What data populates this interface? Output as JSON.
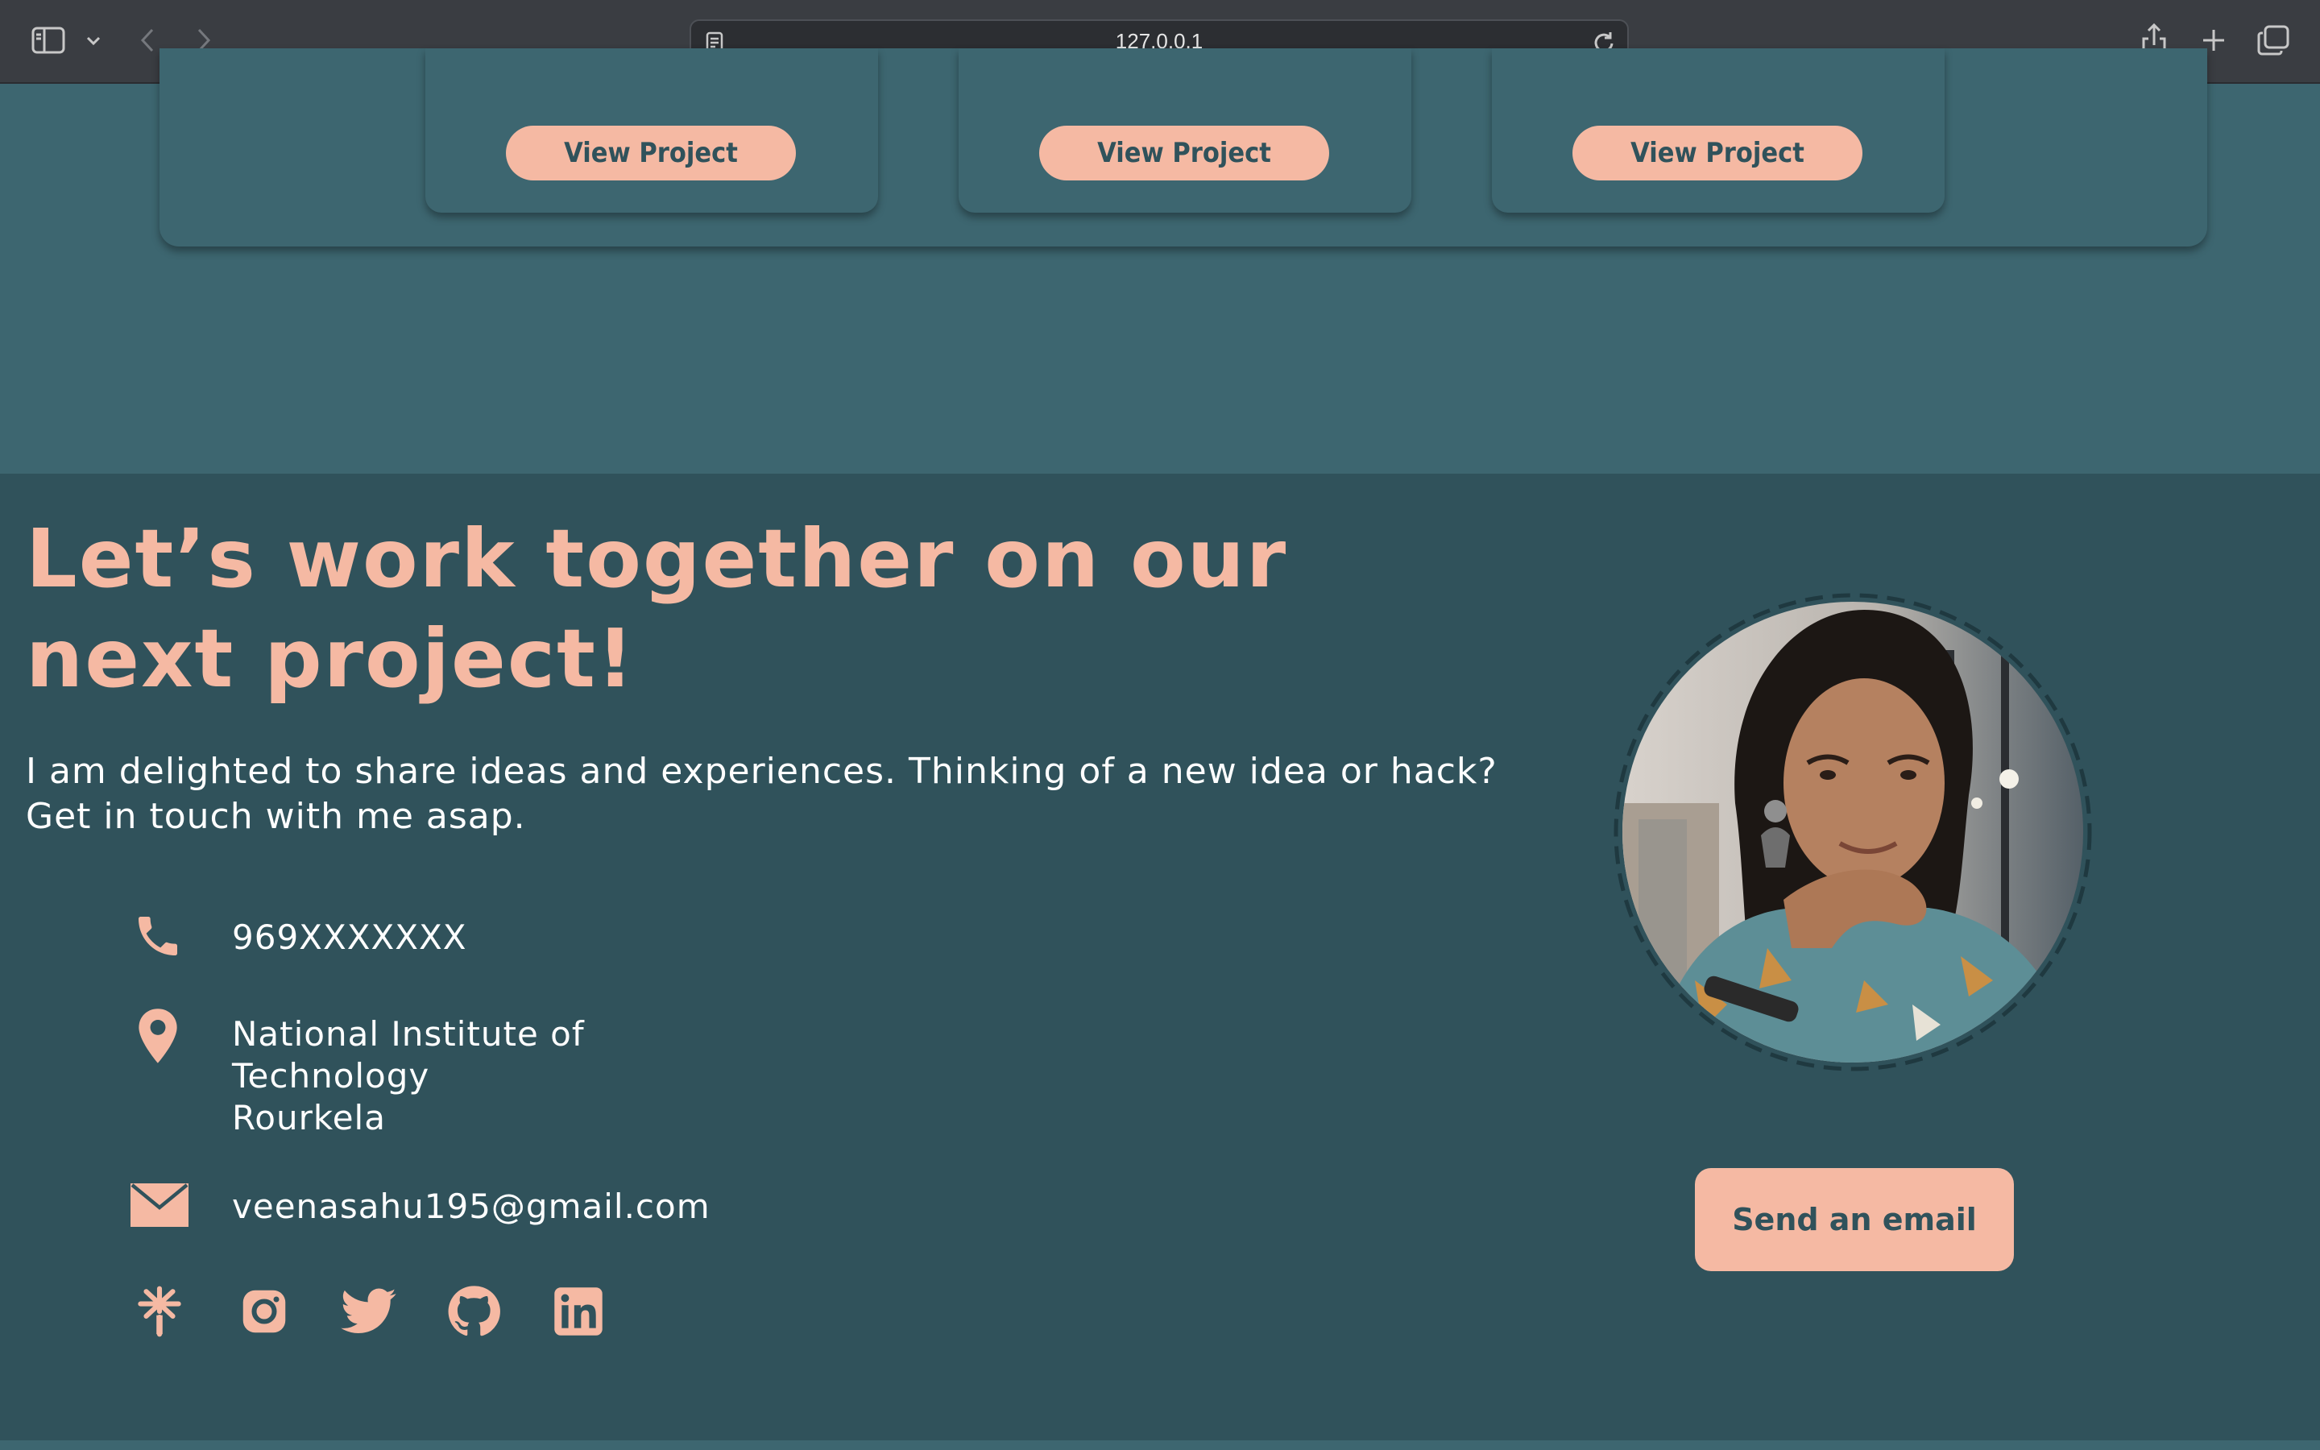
{
  "browser": {
    "url": "127.0.0.1"
  },
  "projects": {
    "cards": [
      {
        "button_label": "View Project"
      },
      {
        "button_label": "View Project"
      },
      {
        "button_label": "View Project"
      }
    ]
  },
  "contact": {
    "heading": "Let’s work together on our next project!",
    "intro": "I am delighted to share ideas and experiences. Thinking of a new idea or hack? Get in touch with me asap.",
    "phone": "969XXXXXXX",
    "address_lines": [
      "National Institute of",
      "Technology",
      "Rourkela"
    ],
    "email": "veenasahu195@gmail.com",
    "send_button": "Send an email",
    "social_icons": [
      "linktree-icon",
      "instagram-icon",
      "twitter-icon",
      "github-icon",
      "linkedin-icon"
    ],
    "avatar_alt": "profile-photo"
  },
  "colors": {
    "page_background": "#3d6670",
    "contact_background": "#30525b",
    "accent": "#f5b9a3",
    "text": "#ffffff"
  }
}
